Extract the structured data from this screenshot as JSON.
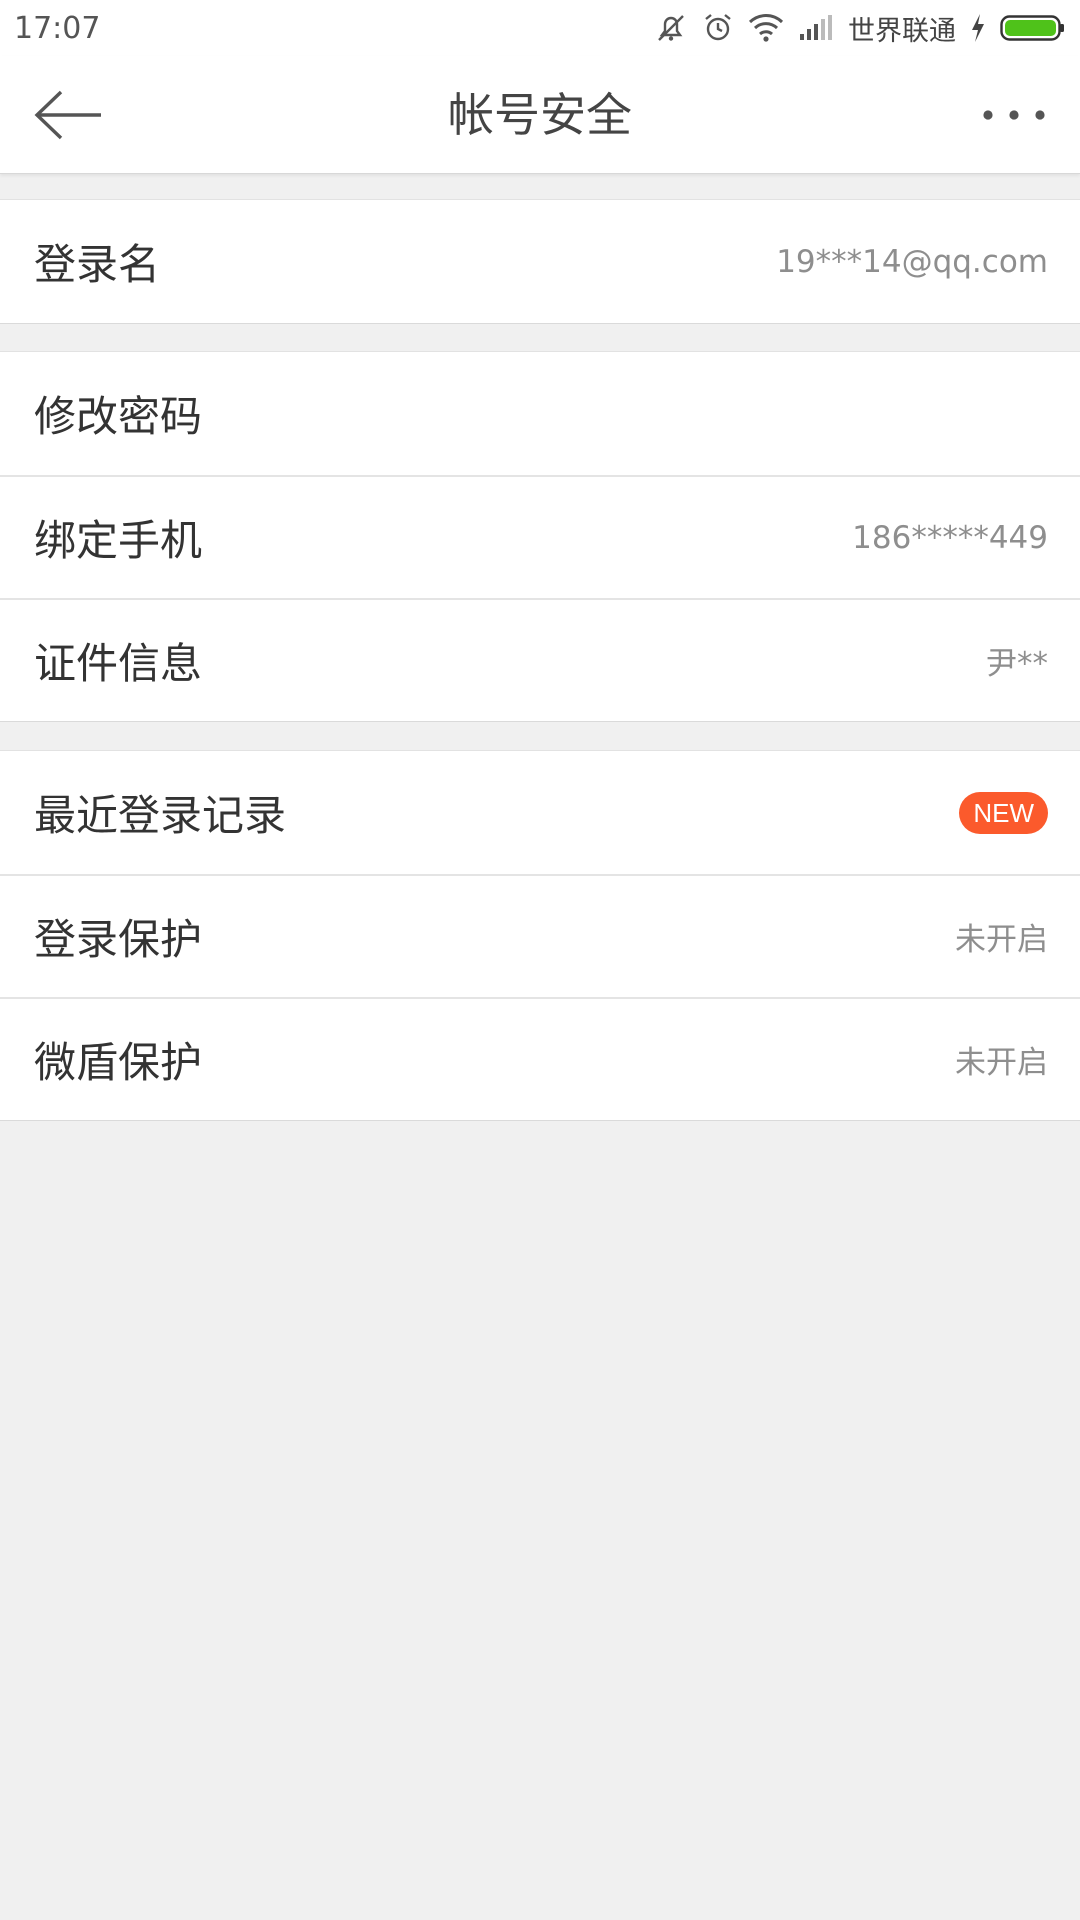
{
  "status_bar": {
    "time": "17:07",
    "carrier": "世界联通",
    "icons": [
      "mute-icon",
      "alarm-icon",
      "wifi-icon",
      "signal-icon",
      "charging-icon",
      "battery-icon"
    ],
    "battery_color": "#4fc21a"
  },
  "header": {
    "title": "帐号安全",
    "back_icon": "arrow-left-icon",
    "more_icon": "more-dots-icon"
  },
  "groups": [
    {
      "rows": [
        {
          "label": "登录名",
          "value": "19***14@qq.com"
        }
      ]
    },
    {
      "rows": [
        {
          "label": "修改密码",
          "value": ""
        },
        {
          "label": "绑定手机",
          "value": "186*****449"
        },
        {
          "label": "证件信息",
          "value": "尹**"
        }
      ]
    },
    {
      "rows": [
        {
          "label": "最近登录记录",
          "badge": "NEW"
        },
        {
          "label": "登录保护",
          "value": "未开启"
        },
        {
          "label": "微盾保护",
          "value": "未开启"
        }
      ]
    }
  ],
  "colors": {
    "badge": "#fb5a2c",
    "background": "#f0f0f0"
  }
}
